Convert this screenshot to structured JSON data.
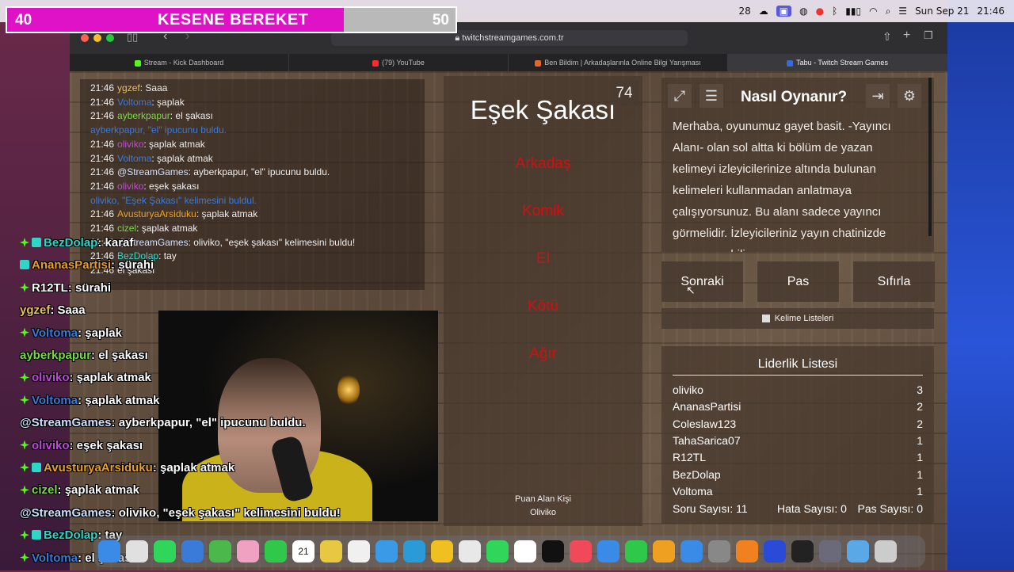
{
  "menubar": {
    "items": [
      "28",
      "Sun Sep 21",
      "21:46"
    ]
  },
  "kesene": {
    "left_level": "40",
    "right_level": "50",
    "title": "KESENE BEREKET",
    "progress": 0.75,
    "fill_color": "#e012c8"
  },
  "browser": {
    "url": "twitchstreamgames.com.tr",
    "tabs": [
      {
        "label": "Stream - Kick Dashboard",
        "color": "#53fc18"
      },
      {
        "label": "(79) YouTube",
        "color": "#ff2a2a"
      },
      {
        "label": "Ben Bildim | Arkadaşlarınla Online Bilgi Yarışması",
        "color": "#e0662a"
      },
      {
        "label": "Tabu - Twitch Stream Games",
        "color": "#3a6ad8"
      }
    ]
  },
  "game_chat": [
    {
      "time": "21:46",
      "user": "ygzef",
      "user_color": "#e8c060",
      "msg": ": Saaa"
    },
    {
      "time": "21:46",
      "user": "Voltoma",
      "user_color": "#3a7ad8",
      "msg": ": şaplak"
    },
    {
      "time": "21:46",
      "user": "ayberkpapur",
      "user_color": "#7ad84a",
      "msg": ": el şakası"
    },
    {
      "time": "",
      "user": "ayberkpapur,",
      "user_color": "#3a7ad8",
      "msg": " \"el\" ipucunu buldu.",
      "sys": true
    },
    {
      "time": "21:46",
      "user": "oliviko",
      "user_color": "#c04ad8",
      "msg": ": şaplak atmak"
    },
    {
      "time": "21:46",
      "user": "Voltoma",
      "user_color": "#3a7ad8",
      "msg": ": şaplak atmak"
    },
    {
      "time": "21:46",
      "user": "@StreamGames",
      "user_color": "#cfe0ff",
      "msg": ": ayberkpapur, \"el\" ipucunu buldu."
    },
    {
      "time": "21:46",
      "user": "oliviko",
      "user_color": "#c04ad8",
      "msg": ": eşek şakası"
    },
    {
      "time": "",
      "user": "oliviko,",
      "user_color": "#3a7ad8",
      "msg": " \"Eşek Şakası\" kelimesini buldul.",
      "sys": true
    },
    {
      "time": "21:46",
      "user": "AvusturyaArsiduku",
      "user_color": "#e8a02a",
      "msg": ": şaplak atmak"
    },
    {
      "time": "21:46",
      "user": "cizel",
      "user_color": "#7ad84a",
      "msg": ": şaplak atmak"
    },
    {
      "time": "21:46",
      "user": "@StreamGames",
      "user_color": "#cfe0ff",
      "msg": ": oliviko, \"eşek şakası\" kelimesini buldu!"
    },
    {
      "time": "21:46",
      "user": "BezDolap",
      "user_color": "#2fd6c8",
      "msg": ": tay"
    },
    {
      "time": "21:46",
      "user": "",
      "user_color": "#eee",
      "msg": "el şakası"
    }
  ],
  "game": {
    "word": "Eşek Şakası",
    "timer": "74",
    "taboo_words": [
      "Arkadaş",
      "Komik",
      "El",
      "Kötü",
      "Ağır"
    ],
    "scorer_label": "Puan Alan Kişi",
    "scorer_name": "Oliviko",
    "taboo_color": "#d01010"
  },
  "howto": {
    "title": "Nasıl Oynanır?",
    "text": "Merhaba, oyunumuz gayet basit. -Yayıncı Alanı- olan sol altta ki bölüm de yazan kelimeyi izleyicilerinize altında bulunan kelimeleri kullanmadan anlatmaya çalışıyorsunuz. Bu alanı sadece yayıncı görmelidir. İzleyicileriniz yayın chatinizde cevap verebilir."
  },
  "actions": {
    "next": "Sonraki",
    "pass": "Pas",
    "reset": "Sıfırla"
  },
  "word_lists_label": "Kelime Listeleri",
  "leaderboard": {
    "title": "Liderlik Listesi",
    "rows": [
      {
        "name": "oliviko",
        "score": "3"
      },
      {
        "name": "AnanasPartisi",
        "score": "2"
      },
      {
        "name": "Coleslaw123",
        "score": "2"
      },
      {
        "name": "TahaSarica07",
        "score": "1"
      },
      {
        "name": "R12TL",
        "score": "1"
      },
      {
        "name": "BezDolap",
        "score": "1"
      },
      {
        "name": "Voltoma",
        "score": "1"
      }
    ],
    "stats": {
      "questions": "Soru Sayısı: 11",
      "errors": "Hata Sayısı: 0",
      "passes": "Pas Sayısı: 0"
    }
  },
  "stream_chat": [
    {
      "badges": [
        "d",
        "s"
      ],
      "user": "BezDolap",
      "user_color": "#2fd6c8",
      "msg": ": karaf"
    },
    {
      "badges": [
        "s"
      ],
      "user": "AnanasPartisi",
      "user_color": "#e8a02a",
      "msg": ": sürahi"
    },
    {
      "badges": [
        "d"
      ],
      "user": "R12TL",
      "user_color": "#ffffff",
      "msg": ": sürahi"
    },
    {
      "badges": [],
      "user": "ygzef",
      "user_color": "#e8c060",
      "msg": ": Saaa"
    },
    {
      "badges": [
        "d"
      ],
      "user": "Voltoma",
      "user_color": "#3a7ad8",
      "msg": ": şaplak"
    },
    {
      "badges": [],
      "user": "ayberkpapur",
      "user_color": "#7ad84a",
      "msg": ": el şakası"
    },
    {
      "badges": [
        "d"
      ],
      "user": "oliviko",
      "user_color": "#c04ad8",
      "msg": ": şaplak atmak"
    },
    {
      "badges": [
        "d"
      ],
      "user": "Voltoma",
      "user_color": "#3a7ad8",
      "msg": ": şaplak atmak"
    },
    {
      "badges": [],
      "user": "@StreamGames",
      "user_color": "#cfe0ff",
      "msg": ": ayberkpapur, \"el\" ipucunu buldu."
    },
    {
      "badges": [
        "d"
      ],
      "user": "oliviko",
      "user_color": "#c04ad8",
      "msg": ": eşek şakası"
    },
    {
      "badges": [
        "d",
        "s"
      ],
      "user": "AvusturyaArsiduku",
      "user_color": "#e8a02a",
      "msg": ": şaplak atmak"
    },
    {
      "badges": [
        "d"
      ],
      "user": "cizel",
      "user_color": "#7ad84a",
      "msg": ": şaplak atmak"
    },
    {
      "badges": [],
      "user": "@StreamGames",
      "user_color": "#cfe0ff",
      "msg": ": oliviko, \"eşek şakası\" kelimesini buldu!"
    },
    {
      "badges": [
        "d",
        "s"
      ],
      "user": "BezDolap",
      "user_color": "#2fd6c8",
      "msg": ": tay"
    },
    {
      "badges": [
        "d"
      ],
      "user": "Voltoma",
      "user_color": "#3a7ad8",
      "msg": ": el şakası"
    }
  ],
  "dock": {
    "date_day": "21",
    "date_month": "SEP",
    "apps": [
      "finder-icon",
      "launchpad-icon",
      "messages-icon",
      "mail-icon",
      "maps-icon",
      "photos-icon",
      "facetime-icon",
      "calendar-icon",
      "notes-icon",
      "reminders-icon",
      "safari-icon",
      "telegram-icon",
      "chrome-icon",
      "files-icon",
      "whatsapp-icon",
      "freeform-icon",
      "tv-icon",
      "music-icon",
      "keynote-icon",
      "numbers-icon",
      "pages-icon",
      "appstore-icon",
      "settings-icon",
      "vlc-icon",
      "wd-icon",
      "obs-icon",
      "quicktime-icon",
      "folder-icon",
      "trash-icon"
    ]
  }
}
